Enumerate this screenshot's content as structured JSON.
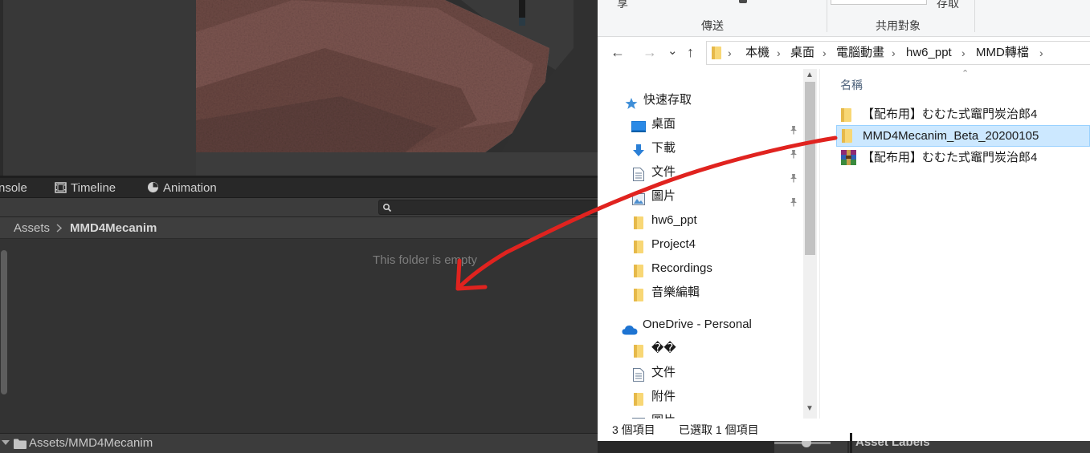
{
  "unity": {
    "tabs": [
      {
        "label": "nsole",
        "icon": "console-icon"
      },
      {
        "label": "Timeline",
        "icon": "film-strip-icon"
      },
      {
        "label": "Animation",
        "icon": "clock-icon"
      }
    ],
    "search": {
      "placeholder": "",
      "icon": "search-icon"
    },
    "breadcrumb": {
      "root": "Assets",
      "current": "MMD4Mecanim"
    },
    "empty_message": "This folder is empty",
    "bottom_path": "Assets/MMD4Mecanim",
    "asset_labels": "Asset Labels"
  },
  "explorer": {
    "ribbon": {
      "top_left_fragment": "享",
      "top_right_fragment": "存取",
      "group_share": "傳送",
      "group_audience": "共用對象"
    },
    "nav_buttons": {
      "back": "←",
      "forward": "→",
      "recent": "⌄",
      "up": "↑"
    },
    "address": [
      "本機",
      "桌面",
      "電腦動畫",
      "hw6_ppt",
      "MMD轉檔"
    ],
    "nav_pane": {
      "quick_access": "快速存取",
      "items": [
        {
          "label": "桌面",
          "icon": "desktop-icon",
          "pinned": true
        },
        {
          "label": "下載",
          "icon": "download-icon",
          "pinned": true
        },
        {
          "label": "文件",
          "icon": "document-icon",
          "pinned": true
        },
        {
          "label": "圖片",
          "icon": "picture-icon",
          "pinned": true
        },
        {
          "label": "hw6_ppt",
          "icon": "folder-icon",
          "pinned": false
        },
        {
          "label": "Project4",
          "icon": "folder-icon",
          "pinned": false
        },
        {
          "label": "Recordings",
          "icon": "folder-icon",
          "pinned": false
        },
        {
          "label": "音樂編輯",
          "icon": "folder-icon",
          "pinned": false
        }
      ],
      "onedrive": "OneDrive - Personal",
      "onedrive_items": [
        {
          "label": "��",
          "icon": "folder-icon"
        },
        {
          "label": "文件",
          "icon": "document-icon"
        },
        {
          "label": "附件",
          "icon": "folder-icon"
        },
        {
          "label": "圖片",
          "icon": "picture-icon"
        }
      ]
    },
    "column_header": "名稱",
    "files": [
      {
        "name": "【配布用】むむた式竈門炭治郎4",
        "icon": "folder-icon",
        "selected": false
      },
      {
        "name": "MMD4Mecanim_Beta_20200105",
        "icon": "folder-icon",
        "selected": true
      },
      {
        "name": "【配布用】むむた式竈門炭治郎4",
        "icon": "winrar-archive-icon",
        "selected": false
      }
    ],
    "status": {
      "count": "3 個項目",
      "selected": "已選取 1 個項目"
    }
  },
  "colors": {
    "unity_bg": "#282828",
    "selection": "#cce8ff",
    "annotation_red": "#e0231f",
    "folder_yellow": "#f8d775"
  }
}
